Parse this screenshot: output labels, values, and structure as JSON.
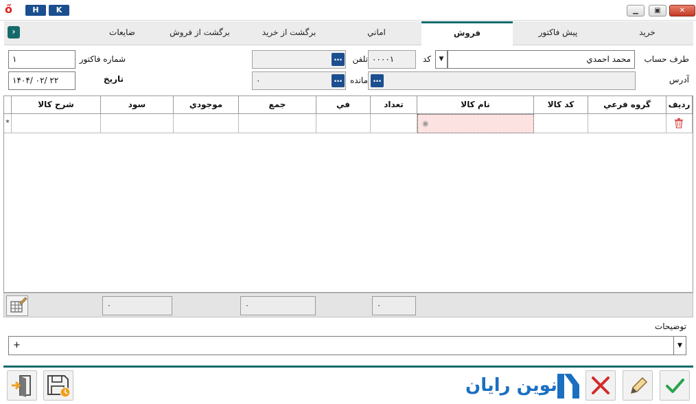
{
  "titlebar": {
    "hotkey_h": "H",
    "hotkey_k": "K"
  },
  "tabs": [
    {
      "label": "خريد"
    },
    {
      "label": "پيش فاكتور"
    },
    {
      "label": "فروش",
      "active": true
    },
    {
      "label": "اماني"
    },
    {
      "label": "برگشت از خريد"
    },
    {
      "label": "برگشت از فروش"
    },
    {
      "label": "ضايعات"
    }
  ],
  "form": {
    "account_label": "طرف حساب",
    "account_value": "محمد احمدي",
    "code_label": "كد",
    "code_value": "۰۰۰۰۱",
    "phone_label": "تلفن",
    "phone_value": "",
    "invoice_no_label": "شماره فاكتور",
    "invoice_no_value": "۱",
    "address_label": "آدرس",
    "address_value": "",
    "balance_label": "مانده",
    "balance_value": "۰",
    "date_label": "تاريخ",
    "date_value": "۱۴۰۴/ ۰۲/ ۲۲"
  },
  "grid": {
    "columns": [
      "رديف",
      "گروه فرعي",
      "كد كالا",
      "نام كالا",
      "تعداد",
      "في",
      "جمع",
      "موجودي",
      "سود",
      "شرح كالا"
    ],
    "new_row_marker": "*"
  },
  "summary": {
    "count_total": "۰",
    "sum_total": "۰",
    "profit_total": "۰"
  },
  "notes": {
    "label": "توضيحات",
    "value": "+"
  },
  "brand": {
    "name": "نوين رايان",
    "accent": "#1b6fc2",
    "theme": "#0f6b6b"
  }
}
